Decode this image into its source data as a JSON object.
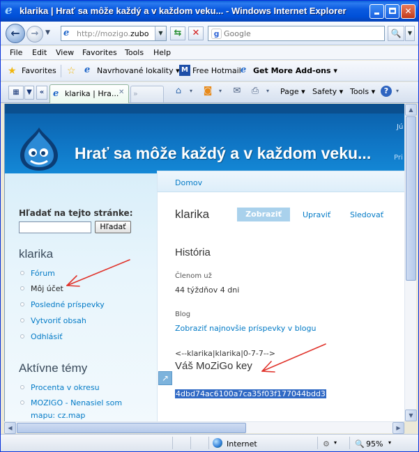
{
  "window": {
    "title": "klarika | Hrať sa môže každý a v každom veku... - Windows Internet Explorer"
  },
  "address": {
    "url_prefix": "http://mozigo.",
    "url_host": "zubo",
    "search_placeholder": "Google"
  },
  "menu": [
    "File",
    "Edit",
    "View",
    "Favorites",
    "Tools",
    "Help"
  ],
  "favorites_bar": {
    "favorites_label": "Favorites",
    "suggested_sites": "Navrhované lokality",
    "free_hotmail": "Free Hotmail",
    "more_addons": "Get More Add-ons"
  },
  "tabs": {
    "active_label": "klarika | Hra...",
    "commands": {
      "page": "Page",
      "safety": "Safety",
      "tools": "Tools"
    }
  },
  "site": {
    "title": "Hrať sa môže každý a v každom veku...",
    "header_right_top": "Jú",
    "header_right_mid": "Pri",
    "sidebar": {
      "search_label": "Hľadať na tejto stránke:",
      "search_button": "Hľadať",
      "user_heading": "klarika",
      "user_links": [
        "Fórum",
        "Môj účet",
        "Posledné príspevky",
        "Vytvoriť obsah",
        "Odhlásiť"
      ],
      "topics_heading": "Aktívne témy",
      "topic_links": [
        "Procenta v okresu",
        "MOZIGO - Nenasiel som",
        "mapu: cz.map"
      ]
    },
    "main": {
      "breadcrumb": "Domov",
      "page_title": "klarika",
      "tabs": [
        "Zobraziť",
        "Upraviť",
        "Sledovať"
      ],
      "history_heading": "História",
      "member_label": "Členom už",
      "member_value": "44 týždňov 4 dni",
      "blog_label": "Blog",
      "blog_link": "Zobraziť najnovšie príspevky v blogu",
      "comment": "<--klarika|klarika|0-7-7-->",
      "key_title": "Váš MoZiGo key",
      "key_value": "4dbd74ac6100a7ca35f03f177044bdd3"
    }
  },
  "status": {
    "zone": "Internet",
    "zoom": "95%"
  },
  "colors": {
    "title_bar": "#0050d8",
    "link": "#027ac6",
    "header_blue": "#0f75c4",
    "selection": "#316ac5",
    "annotation_arrow": "#e0322a"
  }
}
